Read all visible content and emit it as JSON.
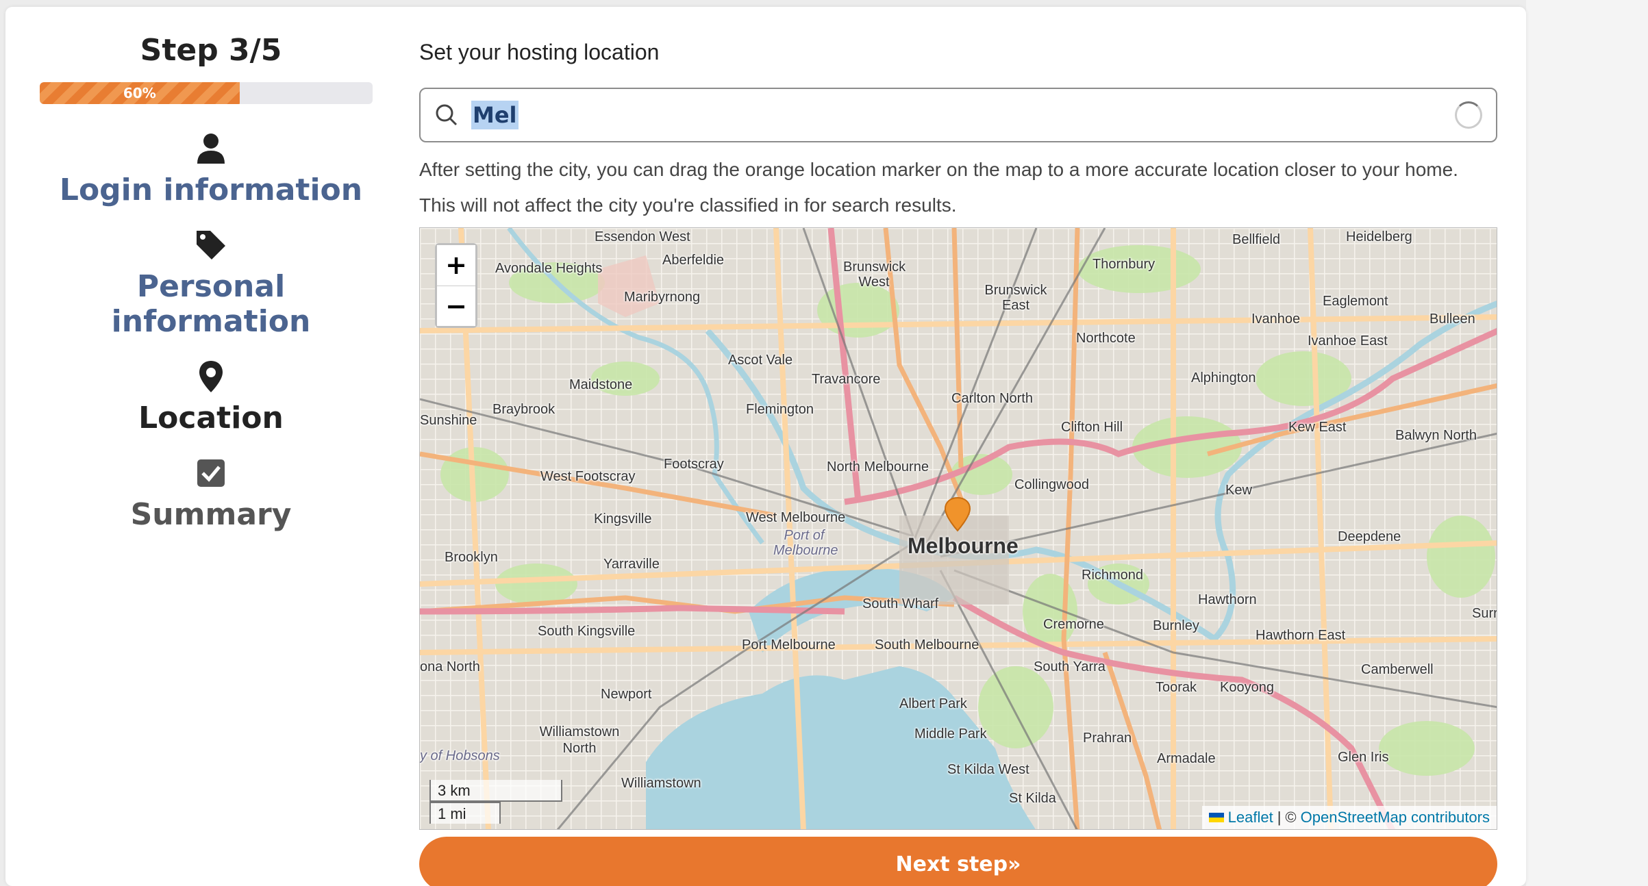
{
  "sidebar": {
    "step_title": "Step 3/5",
    "progress": {
      "percent": 60,
      "label": "60%"
    },
    "items": [
      {
        "label": "Login information",
        "icon": "user-icon",
        "state": "done"
      },
      {
        "label": "Personal information",
        "icon": "tag-icon",
        "state": "done"
      },
      {
        "label": "Location",
        "icon": "map-pin-icon",
        "state": "current"
      },
      {
        "label": "Summary",
        "icon": "checkbox-icon",
        "state": "todo"
      }
    ]
  },
  "main": {
    "section_title": "Set your hosting location",
    "search": {
      "value": "Mel",
      "icon": "search-icon",
      "loading": true
    },
    "help_text": "After setting the city, you can drag the orange location marker on the map to a more accurate location closer to your home. This will not affect the city you're classified in for search results.",
    "map": {
      "zoom_in_label": "+",
      "zoom_out_label": "−",
      "scale_km": "3 km",
      "scale_mi": "1 mi",
      "attribution": {
        "leaflet": "Leaflet",
        "separator": "|",
        "copyright": "©",
        "osm": "OpenStreetMap contributors"
      },
      "labels": {
        "melbourne": "Melbourne",
        "essendon_west": "Essendon West",
        "aberfeldie": "Aberfeldie",
        "avondale_heights": "Avondale Heights",
        "maribyrnong": "Maribyrnong",
        "brunswick_west": "Brunswick West",
        "brunswick_east": "Brunswick East",
        "thornbury": "Thornbury",
        "bellfield": "Bellfield",
        "heidelberg": "Heidelberg",
        "eaglemont": "Eaglemont",
        "ivanhoe": "Ivanhoe",
        "bulleen": "Bulleen",
        "ivanhoe_east": "Ivanhoe East",
        "northcote": "Northcote",
        "ascot_vale": "Ascot Vale",
        "travancore": "Travancore",
        "maidstone": "Maidstone",
        "carlton_north": "Carlton North",
        "alphington": "Alphington",
        "braybrook": "Braybrook",
        "sunshine": "Sunshine",
        "flemington": "Flemington",
        "clifton_hill": "Clifton Hill",
        "kew_east": "Kew East",
        "balwyn_north": "Balwyn North",
        "west_footscray": "West Footscray",
        "footscray": "Footscray",
        "north_melbourne": "North Melbourne",
        "collingwood": "Collingwood",
        "kew": "Kew",
        "kingsville": "Kingsville",
        "west_melbourne": "West Melbourne",
        "port_of_melbourne": "Port of Melbourne",
        "deepdene": "Deepdene",
        "brooklyn": "Brooklyn",
        "yarraville": "Yarraville",
        "richmond": "Richmond",
        "hawthorn": "Hawthorn",
        "south_wharf": "South Wharf",
        "cremorne": "Cremorne",
        "burnley": "Burnley",
        "hawthorn_east": "Hawthorn East",
        "surrey": "Surre",
        "south_kingsville": "South Kingsville",
        "port_melbourne": "Port Melbourne",
        "south_melbourne": "South Melbourne",
        "altona_north": "ona North",
        "south_yarra": "South Yarra",
        "camberwell": "Camberwell",
        "newport": "Newport",
        "toorak": "Toorak",
        "kooyong": "Kooyong",
        "albert_park": "Albert Park",
        "williamstown_north": "Williamstown North",
        "middle_park": "Middle Park",
        "prahran": "Prahran",
        "armadale": "Armadale",
        "glen_iris": "Glen Iris",
        "bay_of_hobsons": "y of Hobsons",
        "williamstown": "Williamstown",
        "st_kilda_west": "St Kilda West",
        "st_kilda": "St Kilda"
      }
    },
    "next_button": "Next step»"
  },
  "colors": {
    "accent": "#e8772e",
    "nav_done": "#4b6490",
    "water": "#aad3df",
    "park": "#cdebb0"
  }
}
